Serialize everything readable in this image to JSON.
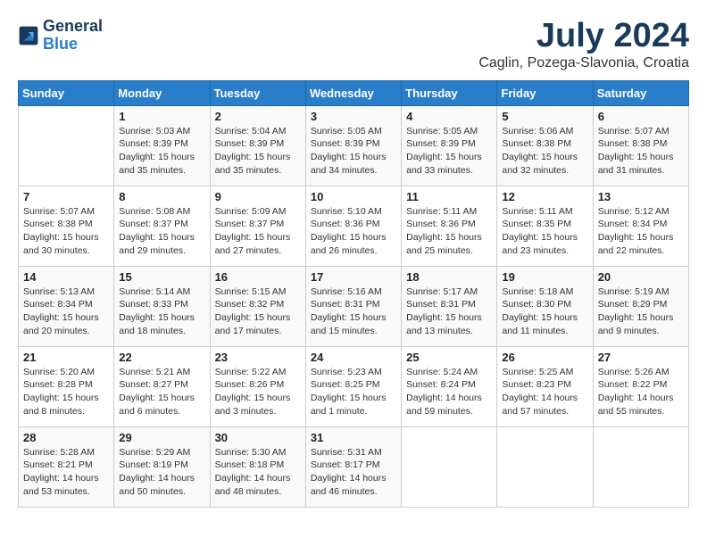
{
  "logo": {
    "line1": "General",
    "line2": "Blue"
  },
  "title": "July 2024",
  "location": "Caglin, Pozega-Slavonia, Croatia",
  "days_header": [
    "Sunday",
    "Monday",
    "Tuesday",
    "Wednesday",
    "Thursday",
    "Friday",
    "Saturday"
  ],
  "weeks": [
    [
      {
        "num": "",
        "info": ""
      },
      {
        "num": "1",
        "info": "Sunrise: 5:03 AM\nSunset: 8:39 PM\nDaylight: 15 hours\nand 35 minutes."
      },
      {
        "num": "2",
        "info": "Sunrise: 5:04 AM\nSunset: 8:39 PM\nDaylight: 15 hours\nand 35 minutes."
      },
      {
        "num": "3",
        "info": "Sunrise: 5:05 AM\nSunset: 8:39 PM\nDaylight: 15 hours\nand 34 minutes."
      },
      {
        "num": "4",
        "info": "Sunrise: 5:05 AM\nSunset: 8:39 PM\nDaylight: 15 hours\nand 33 minutes."
      },
      {
        "num": "5",
        "info": "Sunrise: 5:06 AM\nSunset: 8:38 PM\nDaylight: 15 hours\nand 32 minutes."
      },
      {
        "num": "6",
        "info": "Sunrise: 5:07 AM\nSunset: 8:38 PM\nDaylight: 15 hours\nand 31 minutes."
      }
    ],
    [
      {
        "num": "7",
        "info": "Sunrise: 5:07 AM\nSunset: 8:38 PM\nDaylight: 15 hours\nand 30 minutes."
      },
      {
        "num": "8",
        "info": "Sunrise: 5:08 AM\nSunset: 8:37 PM\nDaylight: 15 hours\nand 29 minutes."
      },
      {
        "num": "9",
        "info": "Sunrise: 5:09 AM\nSunset: 8:37 PM\nDaylight: 15 hours\nand 27 minutes."
      },
      {
        "num": "10",
        "info": "Sunrise: 5:10 AM\nSunset: 8:36 PM\nDaylight: 15 hours\nand 26 minutes."
      },
      {
        "num": "11",
        "info": "Sunrise: 5:11 AM\nSunset: 8:36 PM\nDaylight: 15 hours\nand 25 minutes."
      },
      {
        "num": "12",
        "info": "Sunrise: 5:11 AM\nSunset: 8:35 PM\nDaylight: 15 hours\nand 23 minutes."
      },
      {
        "num": "13",
        "info": "Sunrise: 5:12 AM\nSunset: 8:34 PM\nDaylight: 15 hours\nand 22 minutes."
      }
    ],
    [
      {
        "num": "14",
        "info": "Sunrise: 5:13 AM\nSunset: 8:34 PM\nDaylight: 15 hours\nand 20 minutes."
      },
      {
        "num": "15",
        "info": "Sunrise: 5:14 AM\nSunset: 8:33 PM\nDaylight: 15 hours\nand 18 minutes."
      },
      {
        "num": "16",
        "info": "Sunrise: 5:15 AM\nSunset: 8:32 PM\nDaylight: 15 hours\nand 17 minutes."
      },
      {
        "num": "17",
        "info": "Sunrise: 5:16 AM\nSunset: 8:31 PM\nDaylight: 15 hours\nand 15 minutes."
      },
      {
        "num": "18",
        "info": "Sunrise: 5:17 AM\nSunset: 8:31 PM\nDaylight: 15 hours\nand 13 minutes."
      },
      {
        "num": "19",
        "info": "Sunrise: 5:18 AM\nSunset: 8:30 PM\nDaylight: 15 hours\nand 11 minutes."
      },
      {
        "num": "20",
        "info": "Sunrise: 5:19 AM\nSunset: 8:29 PM\nDaylight: 15 hours\nand 9 minutes."
      }
    ],
    [
      {
        "num": "21",
        "info": "Sunrise: 5:20 AM\nSunset: 8:28 PM\nDaylight: 15 hours\nand 8 minutes."
      },
      {
        "num": "22",
        "info": "Sunrise: 5:21 AM\nSunset: 8:27 PM\nDaylight: 15 hours\nand 6 minutes."
      },
      {
        "num": "23",
        "info": "Sunrise: 5:22 AM\nSunset: 8:26 PM\nDaylight: 15 hours\nand 3 minutes."
      },
      {
        "num": "24",
        "info": "Sunrise: 5:23 AM\nSunset: 8:25 PM\nDaylight: 15 hours\nand 1 minute."
      },
      {
        "num": "25",
        "info": "Sunrise: 5:24 AM\nSunset: 8:24 PM\nDaylight: 14 hours\nand 59 minutes."
      },
      {
        "num": "26",
        "info": "Sunrise: 5:25 AM\nSunset: 8:23 PM\nDaylight: 14 hours\nand 57 minutes."
      },
      {
        "num": "27",
        "info": "Sunrise: 5:26 AM\nSunset: 8:22 PM\nDaylight: 14 hours\nand 55 minutes."
      }
    ],
    [
      {
        "num": "28",
        "info": "Sunrise: 5:28 AM\nSunset: 8:21 PM\nDaylight: 14 hours\nand 53 minutes."
      },
      {
        "num": "29",
        "info": "Sunrise: 5:29 AM\nSunset: 8:19 PM\nDaylight: 14 hours\nand 50 minutes."
      },
      {
        "num": "30",
        "info": "Sunrise: 5:30 AM\nSunset: 8:18 PM\nDaylight: 14 hours\nand 48 minutes."
      },
      {
        "num": "31",
        "info": "Sunrise: 5:31 AM\nSunset: 8:17 PM\nDaylight: 14 hours\nand 46 minutes."
      },
      {
        "num": "",
        "info": ""
      },
      {
        "num": "",
        "info": ""
      },
      {
        "num": "",
        "info": ""
      }
    ]
  ]
}
